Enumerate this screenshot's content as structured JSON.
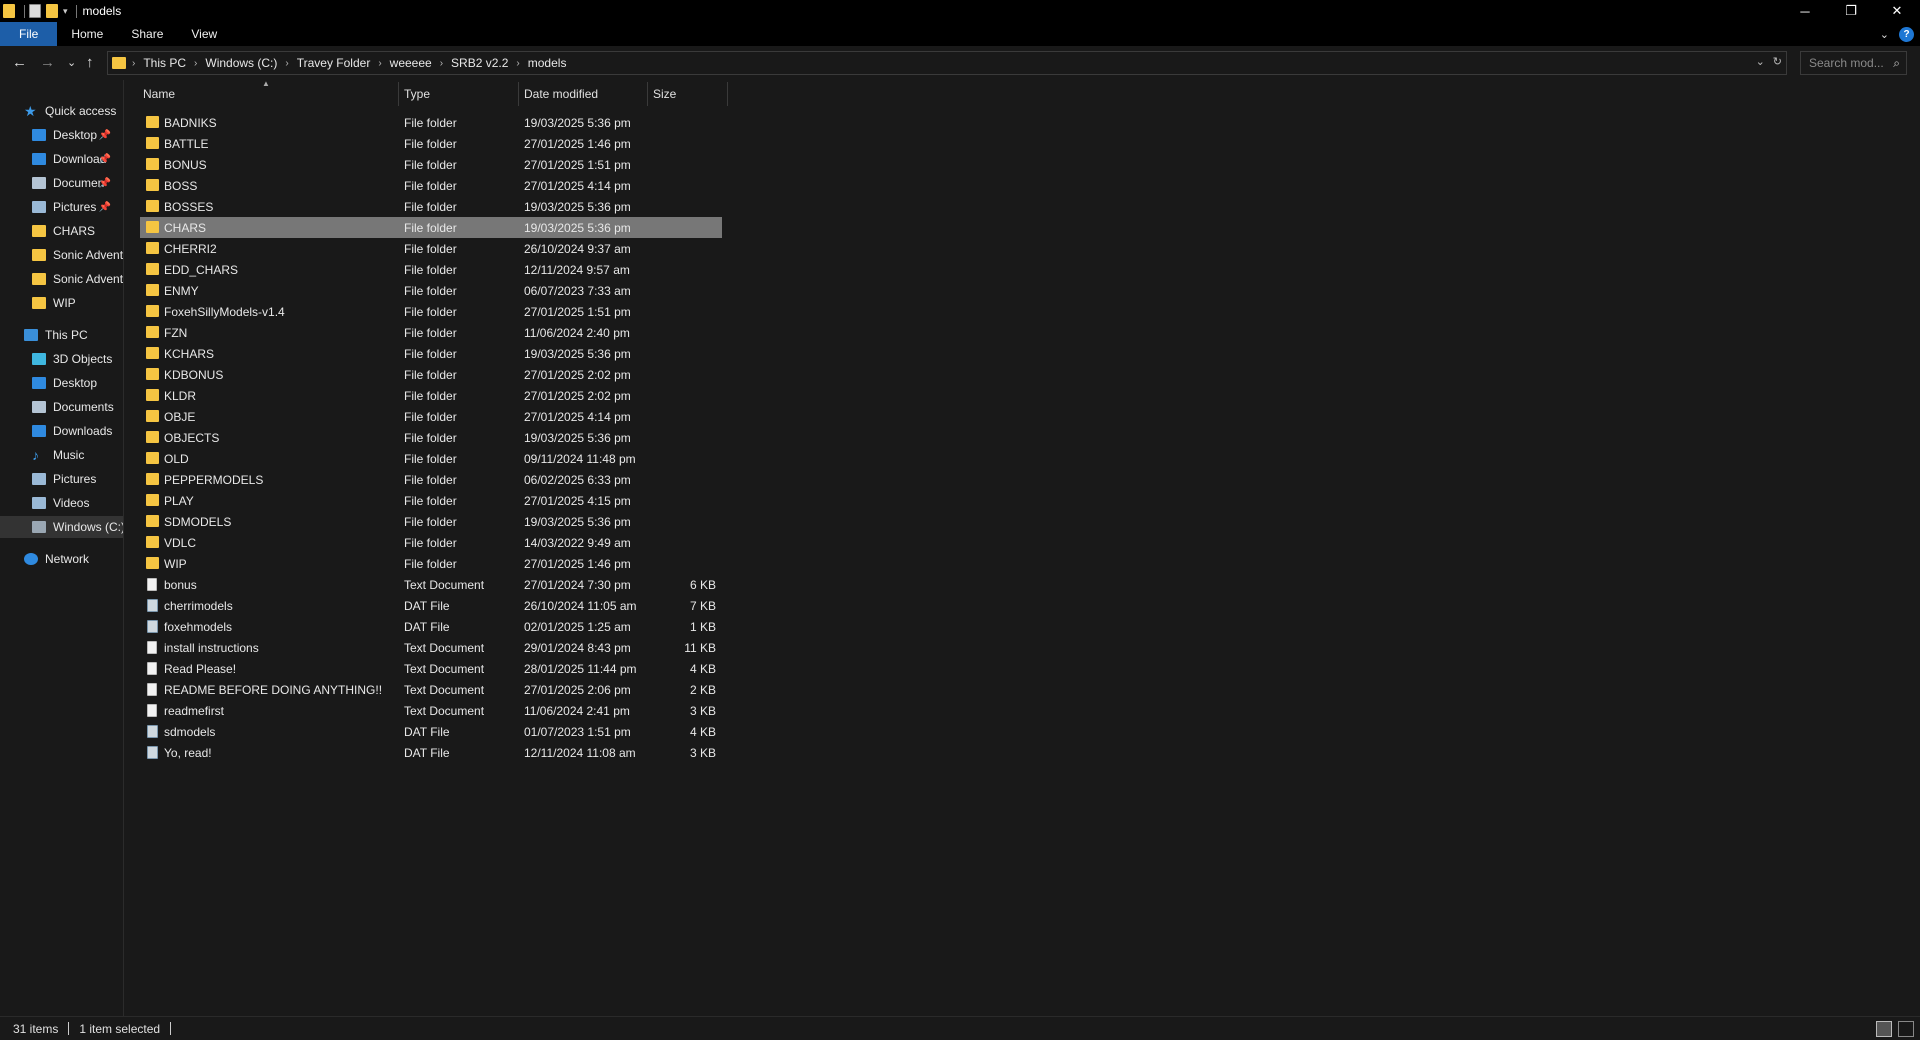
{
  "window": {
    "title": "models",
    "minimize": "─",
    "restore": "❐",
    "close": "✕"
  },
  "ribbon": {
    "tabs": [
      "File",
      "Home",
      "Share",
      "View"
    ],
    "help": "?"
  },
  "nav_buttons": {
    "back": "←",
    "forward": "→",
    "recent": "⌄",
    "up": "↑"
  },
  "address": {
    "crumbs": [
      "This PC",
      "Windows (C:)",
      "Travey Folder",
      "weeeee",
      "SRB2 v2.2",
      "models"
    ],
    "separator": "›"
  },
  "search": {
    "placeholder": "Search mod..."
  },
  "navpane": {
    "quick_access": "Quick access",
    "quick_items": [
      {
        "label": "Desktop",
        "icon": "desktop-icon",
        "pinned": true
      },
      {
        "label": "Download",
        "icon": "downloads-icon",
        "pinned": true
      },
      {
        "label": "Documen",
        "icon": "documents-icon",
        "pinned": true
      },
      {
        "label": "Pictures",
        "icon": "pictures-icon",
        "pinned": true
      },
      {
        "label": "CHARS",
        "icon": "folder-icon",
        "pinned": false
      },
      {
        "label": "Sonic Advent",
        "icon": "folder-icon",
        "pinned": false
      },
      {
        "label": "Sonic Advent",
        "icon": "folder-icon",
        "pinned": false
      },
      {
        "label": "WIP",
        "icon": "folder-icon",
        "pinned": false
      }
    ],
    "this_pc": "This PC",
    "pc_items": [
      {
        "label": "3D Objects",
        "icon": "3d-objects-icon"
      },
      {
        "label": "Desktop",
        "icon": "desktop-icon"
      },
      {
        "label": "Documents",
        "icon": "documents-icon"
      },
      {
        "label": "Downloads",
        "icon": "downloads-icon"
      },
      {
        "label": "Music",
        "icon": "music-icon"
      },
      {
        "label": "Pictures",
        "icon": "pictures-icon"
      },
      {
        "label": "Videos",
        "icon": "videos-icon"
      },
      {
        "label": "Windows (C:)",
        "icon": "drive-icon"
      }
    ],
    "network": "Network"
  },
  "columns": {
    "name": "Name",
    "type": "Type",
    "date": "Date modified",
    "size": "Size"
  },
  "files": [
    {
      "name": "BADNIKS",
      "type": "File folder",
      "date": "19/03/2025 5:36 pm",
      "size": "",
      "kind": "folder"
    },
    {
      "name": "BATTLE",
      "type": "File folder",
      "date": "27/01/2025 1:46 pm",
      "size": "",
      "kind": "folder"
    },
    {
      "name": "BONUS",
      "type": "File folder",
      "date": "27/01/2025 1:51 pm",
      "size": "",
      "kind": "folder"
    },
    {
      "name": "BOSS",
      "type": "File folder",
      "date": "27/01/2025 4:14 pm",
      "size": "",
      "kind": "folder"
    },
    {
      "name": "BOSSES",
      "type": "File folder",
      "date": "19/03/2025 5:36 pm",
      "size": "",
      "kind": "folder"
    },
    {
      "name": "CHARS",
      "type": "File folder",
      "date": "19/03/2025 5:36 pm",
      "size": "",
      "kind": "folder",
      "selected": true
    },
    {
      "name": "CHERRI2",
      "type": "File folder",
      "date": "26/10/2024 9:37 am",
      "size": "",
      "kind": "folder"
    },
    {
      "name": "EDD_CHARS",
      "type": "File folder",
      "date": "12/11/2024 9:57 am",
      "size": "",
      "kind": "folder"
    },
    {
      "name": "ENMY",
      "type": "File folder",
      "date": "06/07/2023 7:33 am",
      "size": "",
      "kind": "folder"
    },
    {
      "name": "FoxehSillyModels-v1.4",
      "type": "File folder",
      "date": "27/01/2025 1:51 pm",
      "size": "",
      "kind": "folder"
    },
    {
      "name": "FZN",
      "type": "File folder",
      "date": "11/06/2024 2:40 pm",
      "size": "",
      "kind": "folder"
    },
    {
      "name": "KCHARS",
      "type": "File folder",
      "date": "19/03/2025 5:36 pm",
      "size": "",
      "kind": "folder"
    },
    {
      "name": "KDBONUS",
      "type": "File folder",
      "date": "27/01/2025 2:02 pm",
      "size": "",
      "kind": "folder"
    },
    {
      "name": "KLDR",
      "type": "File folder",
      "date": "27/01/2025 2:02 pm",
      "size": "",
      "kind": "folder"
    },
    {
      "name": "OBJE",
      "type": "File folder",
      "date": "27/01/2025 4:14 pm",
      "size": "",
      "kind": "folder"
    },
    {
      "name": "OBJECTS",
      "type": "File folder",
      "date": "19/03/2025 5:36 pm",
      "size": "",
      "kind": "folder"
    },
    {
      "name": "OLD",
      "type": "File folder",
      "date": "09/11/2024 11:48 pm",
      "size": "",
      "kind": "folder"
    },
    {
      "name": "PEPPERMODELS",
      "type": "File folder",
      "date": "06/02/2025 6:33 pm",
      "size": "",
      "kind": "folder"
    },
    {
      "name": "PLAY",
      "type": "File folder",
      "date": "27/01/2025 4:15 pm",
      "size": "",
      "kind": "folder"
    },
    {
      "name": "SDMODELS",
      "type": "File folder",
      "date": "19/03/2025 5:36 pm",
      "size": "",
      "kind": "folder"
    },
    {
      "name": "VDLC",
      "type": "File folder",
      "date": "14/03/2022 9:49 am",
      "size": "",
      "kind": "folder"
    },
    {
      "name": "WIP",
      "type": "File folder",
      "date": "27/01/2025 1:46 pm",
      "size": "",
      "kind": "folder"
    },
    {
      "name": "bonus",
      "type": "Text Document",
      "date": "27/01/2024 7:30 pm",
      "size": "6 KB",
      "kind": "txt"
    },
    {
      "name": "cherrimodels",
      "type": "DAT File",
      "date": "26/10/2024 11:05 am",
      "size": "7 KB",
      "kind": "dat"
    },
    {
      "name": "foxehmodels",
      "type": "DAT File",
      "date": "02/01/2025 1:25 am",
      "size": "1 KB",
      "kind": "dat"
    },
    {
      "name": "install instructions",
      "type": "Text Document",
      "date": "29/01/2024 8:43 pm",
      "size": "11 KB",
      "kind": "txt"
    },
    {
      "name": "Read Please!",
      "type": "Text Document",
      "date": "28/01/2025 11:44 pm",
      "size": "4 KB",
      "kind": "txt"
    },
    {
      "name": "README BEFORE DOING ANYTHING!!",
      "type": "Text Document",
      "date": "27/01/2025 2:06 pm",
      "size": "2 KB",
      "kind": "txt"
    },
    {
      "name": "readmefirst",
      "type": "Text Document",
      "date": "11/06/2024 2:41 pm",
      "size": "3 KB",
      "kind": "txt"
    },
    {
      "name": "sdmodels",
      "type": "DAT File",
      "date": "01/07/2023 1:51 pm",
      "size": "4 KB",
      "kind": "dat"
    },
    {
      "name": "Yo, read!",
      "type": "DAT File",
      "date": "12/11/2024 11:08 am",
      "size": "3 KB",
      "kind": "dat"
    }
  ],
  "status": {
    "count": "31 items",
    "selected": "1 item selected"
  },
  "colors": {
    "folder": "#f5c542",
    "selection": "#777777",
    "file_tab": "#1d5ea8",
    "background": "#191919"
  }
}
